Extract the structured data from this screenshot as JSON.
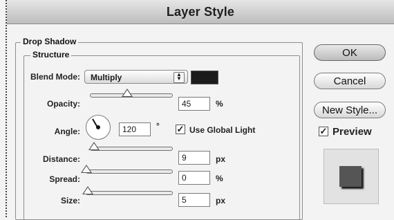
{
  "window": {
    "title": "Layer Style"
  },
  "drop_shadow": {
    "group_label": "Drop Shadow",
    "structure_label": "Structure",
    "blend_mode": {
      "label": "Blend Mode:",
      "value": "Multiply",
      "color": "#1b1b1b"
    },
    "opacity": {
      "label": "Opacity:",
      "value": "45",
      "unit": "%",
      "slider": 0.45
    },
    "angle": {
      "label": "Angle:",
      "value": "120",
      "unit": "°",
      "use_global_light_label": "Use Global Light",
      "use_global_light_checked": true
    },
    "distance": {
      "label": "Distance:",
      "value": "9",
      "unit": "px",
      "slider": 0.04
    },
    "spread": {
      "label": "Spread:",
      "value": "0",
      "unit": "%",
      "slider": 0.0
    },
    "size": {
      "label": "Size:",
      "value": "5",
      "unit": "px",
      "slider": 0.02
    }
  },
  "buttons": {
    "ok": "OK",
    "cancel": "Cancel",
    "new_style": "New Style..."
  },
  "preview": {
    "label": "Preview",
    "checked": true
  }
}
